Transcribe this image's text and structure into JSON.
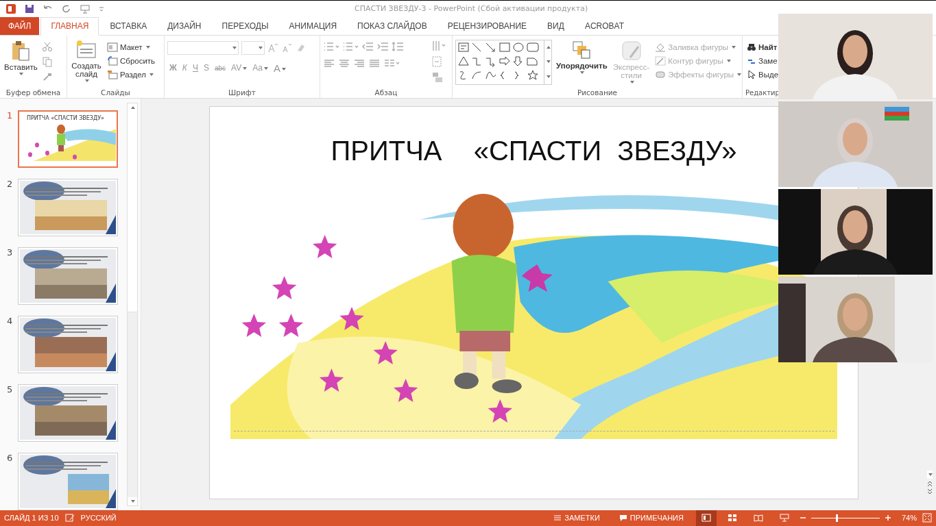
{
  "title_bar": {
    "title": "СПАСТИ ЗВЕЗДУ-3 - PowerPoint (Сбой активации продукта)"
  },
  "tabs": [
    {
      "label": "ФАЙЛ",
      "kind": "file",
      "selected": false
    },
    {
      "label": "ГЛАВНАЯ",
      "kind": "tab",
      "selected": true
    },
    {
      "label": "ВСТАВКА",
      "kind": "tab",
      "selected": false
    },
    {
      "label": "ДИЗАЙН",
      "kind": "tab",
      "selected": false
    },
    {
      "label": "ПЕРЕХОДЫ",
      "kind": "tab",
      "selected": false
    },
    {
      "label": "АНИМАЦИЯ",
      "kind": "tab",
      "selected": false
    },
    {
      "label": "ПОКАЗ СЛАЙДОВ",
      "kind": "tab",
      "selected": false
    },
    {
      "label": "РЕЦЕНЗИРОВАНИЕ",
      "kind": "tab",
      "selected": false
    },
    {
      "label": "ВИД",
      "kind": "tab",
      "selected": false
    },
    {
      "label": "ACROBAT",
      "kind": "tab",
      "selected": false
    }
  ],
  "ribbon": {
    "clipboard": {
      "label": "Буфер обмена",
      "paste": "Вставить"
    },
    "slides": {
      "label": "Слайды",
      "new_slide": "Создать слайд",
      "items": [
        "Макет",
        "Сбросить",
        "Раздел"
      ]
    },
    "font": {
      "label": "Шрифт",
      "buttons": [
        "Ж",
        "К",
        "Ч",
        "S",
        "abc",
        "AV",
        "Aa",
        "A"
      ]
    },
    "paragraph": {
      "label": "Абзац"
    },
    "drawing": {
      "label": "Рисование",
      "arrange": "Упорядочить",
      "quick_styles": {
        "label": "Экспресс-стили",
        "disabled": true
      },
      "items": [
        {
          "label": "Заливка фигуры",
          "disabled": true
        },
        {
          "label": "Контур фигуры",
          "disabled": true
        },
        {
          "label": "Эффекты фигуры",
          "disabled": true
        }
      ]
    },
    "editing": {
      "label": "Редактир",
      "items": [
        "Найт",
        "Заме",
        "Выде"
      ]
    }
  },
  "thumbnails": [
    {
      "number": "1",
      "selected": true,
      "title": "ПРИТЧА «СПАСТИ ЗВЕЗДУ»"
    },
    {
      "number": "2",
      "selected": false
    },
    {
      "number": "3",
      "selected": false
    },
    {
      "number": "4",
      "selected": false
    },
    {
      "number": "5",
      "selected": false
    },
    {
      "number": "6",
      "selected": false
    }
  ],
  "slide": {
    "title": "ПРИТЧА  «СПАСТИ ЗВЕЗДУ»"
  },
  "status_bar": {
    "slide_counter": "СЛАЙД 1 ИЗ 10",
    "language": "РУССКИЙ",
    "notes": "ЗАМЕТКИ",
    "comments": "ПРИМЕЧАНИЯ",
    "view_buttons": [
      {
        "selected": true
      },
      {
        "selected": false
      },
      {
        "selected": false
      },
      {
        "selected": false
      }
    ],
    "zoom": {
      "level": 0.37,
      "reading": "74%"
    }
  }
}
